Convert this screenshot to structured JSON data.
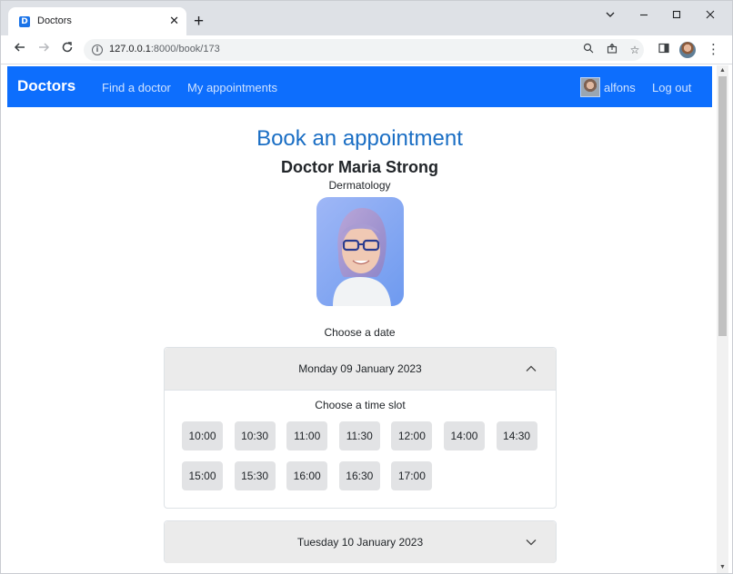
{
  "browser": {
    "tab_title": "Doctors",
    "tab_favicon_letter": "D",
    "url_host": "127.0.0.1",
    "url_rest": ":8000/book/173"
  },
  "navbar": {
    "brand": "Doctors",
    "links": [
      "Find a doctor",
      "My appointments"
    ],
    "username": "alfons",
    "logout": "Log out",
    "color": "#0d6efd"
  },
  "page": {
    "title": "Book an appointment",
    "doctor_name": "Doctor Maria Strong",
    "specialty": "Dermatology",
    "choose_date_label": "Choose a date"
  },
  "dates": [
    {
      "label": "Monday 09 January 2023",
      "expanded": true,
      "slot_title": "Choose a time slot",
      "slots": [
        "10:00",
        "10:30",
        "11:00",
        "11:30",
        "12:00",
        "14:00",
        "14:30",
        "15:00",
        "15:30",
        "16:00",
        "16:30",
        "17:00"
      ]
    },
    {
      "label": "Tuesday 10 January 2023",
      "expanded": false
    }
  ]
}
